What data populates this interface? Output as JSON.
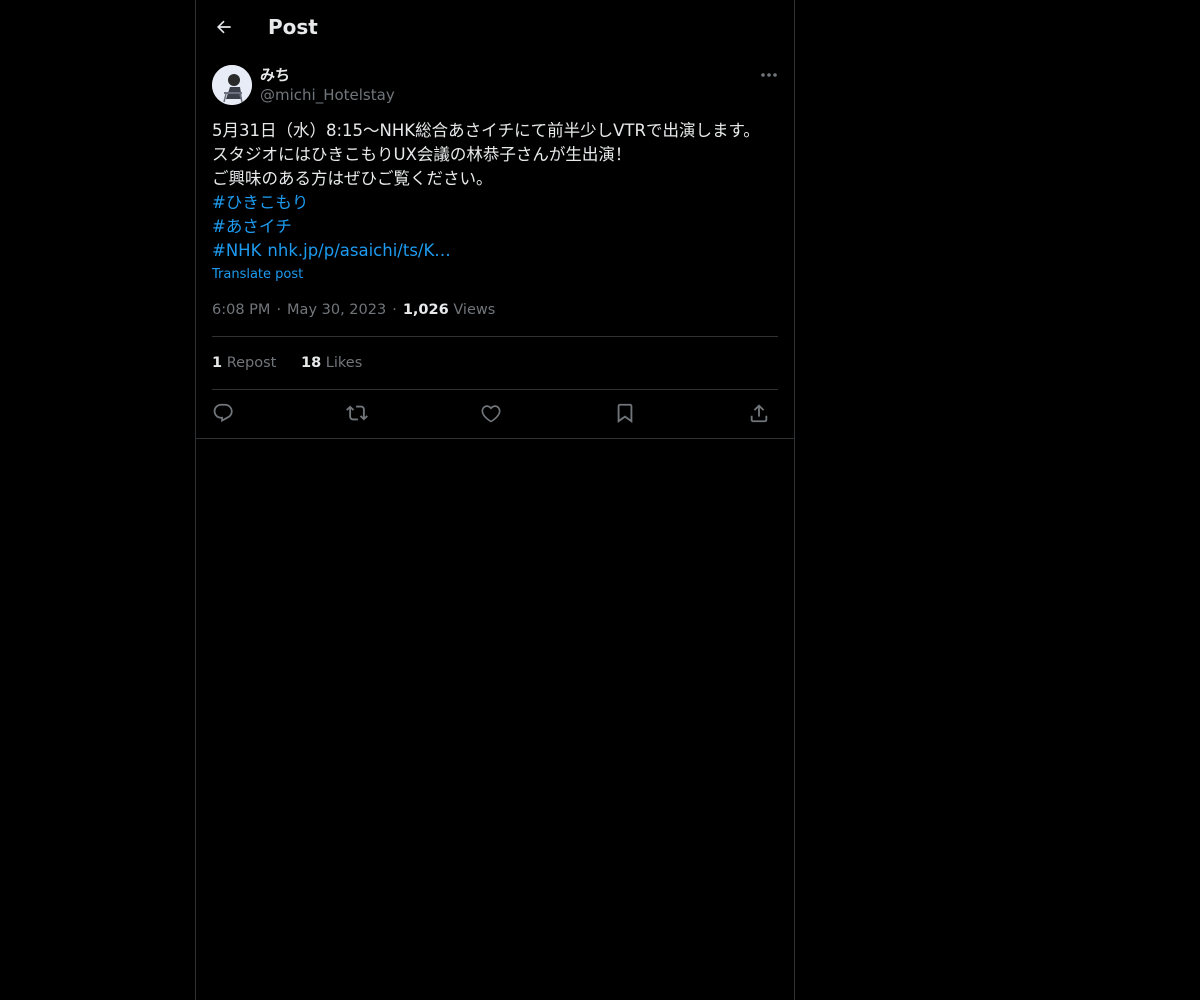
{
  "header": {
    "title": "Post"
  },
  "post": {
    "author": {
      "display_name": "みち",
      "handle": "@michi_Hotelstay"
    },
    "lines": [
      "5月31日（水）8:15〜NHK総合あさイチにて前半少しVTRで出演します。",
      "スタジオにはひきこもりUX会議の林恭子さんが生出演！",
      "ご興味のある方はぜひご覧ください。"
    ],
    "hashtags": [
      "#ひきこもり",
      "#あさイチ",
      "#NHK"
    ],
    "link": "nhk.jp/p/asaichi/ts/K…",
    "translate_label": "Translate post",
    "time": "6:08 PM",
    "date": "May 30, 2023",
    "separator": "·",
    "views_count": "1,026",
    "views_label": "Views",
    "reposts_count": "1",
    "reposts_label": "Repost",
    "likes_count": "18",
    "likes_label": "Likes"
  },
  "icons": {
    "back": "arrow-left-icon",
    "more": "more-horizontal-icon",
    "reply": "reply-icon",
    "repost": "repost-icon",
    "like": "heart-icon",
    "bookmark": "bookmark-icon",
    "share": "share-icon"
  },
  "colors": {
    "background": "#000000",
    "text": "#e7e9ea",
    "muted": "#71767b",
    "accent": "#1d9bf0",
    "border": "#2f3336"
  }
}
